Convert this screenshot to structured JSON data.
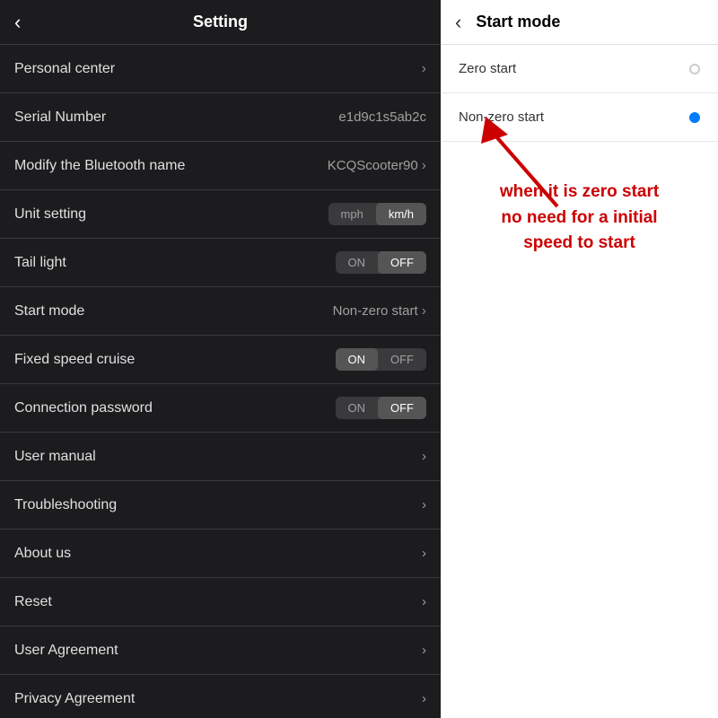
{
  "settings": {
    "header": {
      "back_label": "‹",
      "title": "Setting"
    },
    "items": [
      {
        "id": "personal-center",
        "label": "Personal center",
        "value": "",
        "type": "nav"
      },
      {
        "id": "serial-number",
        "label": "Serial Number",
        "value": "e1d9c1s5ab2c",
        "type": "text"
      },
      {
        "id": "bluetooth-name",
        "label": "Modify the Bluetooth name",
        "value": "KCQScooter90",
        "type": "nav"
      },
      {
        "id": "unit-setting",
        "label": "Unit setting",
        "value": "",
        "type": "toggle-unit",
        "options": [
          "mph",
          "km/h"
        ],
        "active": 1
      },
      {
        "id": "tail-light",
        "label": "Tail light",
        "value": "",
        "type": "toggle-onoff",
        "options": [
          "ON",
          "OFF"
        ],
        "active": 1
      },
      {
        "id": "start-mode",
        "label": "Start mode",
        "value": "Non-zero start",
        "type": "nav"
      },
      {
        "id": "fixed-speed-cruise",
        "label": "Fixed speed cruise",
        "value": "",
        "type": "toggle-onoff",
        "options": [
          "ON",
          "OFF"
        ],
        "active": 0
      },
      {
        "id": "connection-password",
        "label": "Connection password",
        "value": "",
        "type": "toggle-onoff",
        "options": [
          "ON",
          "OFF"
        ],
        "active": 1
      },
      {
        "id": "user-manual",
        "label": "User manual",
        "value": "",
        "type": "nav"
      },
      {
        "id": "troubleshooting",
        "label": "Troubleshooting",
        "value": "",
        "type": "nav"
      },
      {
        "id": "about-us",
        "label": "About us",
        "value": "",
        "type": "nav"
      },
      {
        "id": "reset",
        "label": "Reset",
        "value": "",
        "type": "nav"
      },
      {
        "id": "user-agreement",
        "label": "User Agreement",
        "value": "",
        "type": "nav"
      },
      {
        "id": "privacy-agreement",
        "label": "Privacy Agreement",
        "value": "",
        "type": "nav"
      }
    ]
  },
  "startmode": {
    "header": {
      "back_label": "‹",
      "title": "Start mode"
    },
    "options": [
      {
        "id": "zero-start",
        "label": "Zero start",
        "selected": false
      },
      {
        "id": "non-zero-start",
        "label": "Non-zero start",
        "selected": true
      }
    ],
    "annotation": {
      "line1": "when it is zero start",
      "line2": "no need for a initial",
      "line3": "speed to start"
    }
  }
}
